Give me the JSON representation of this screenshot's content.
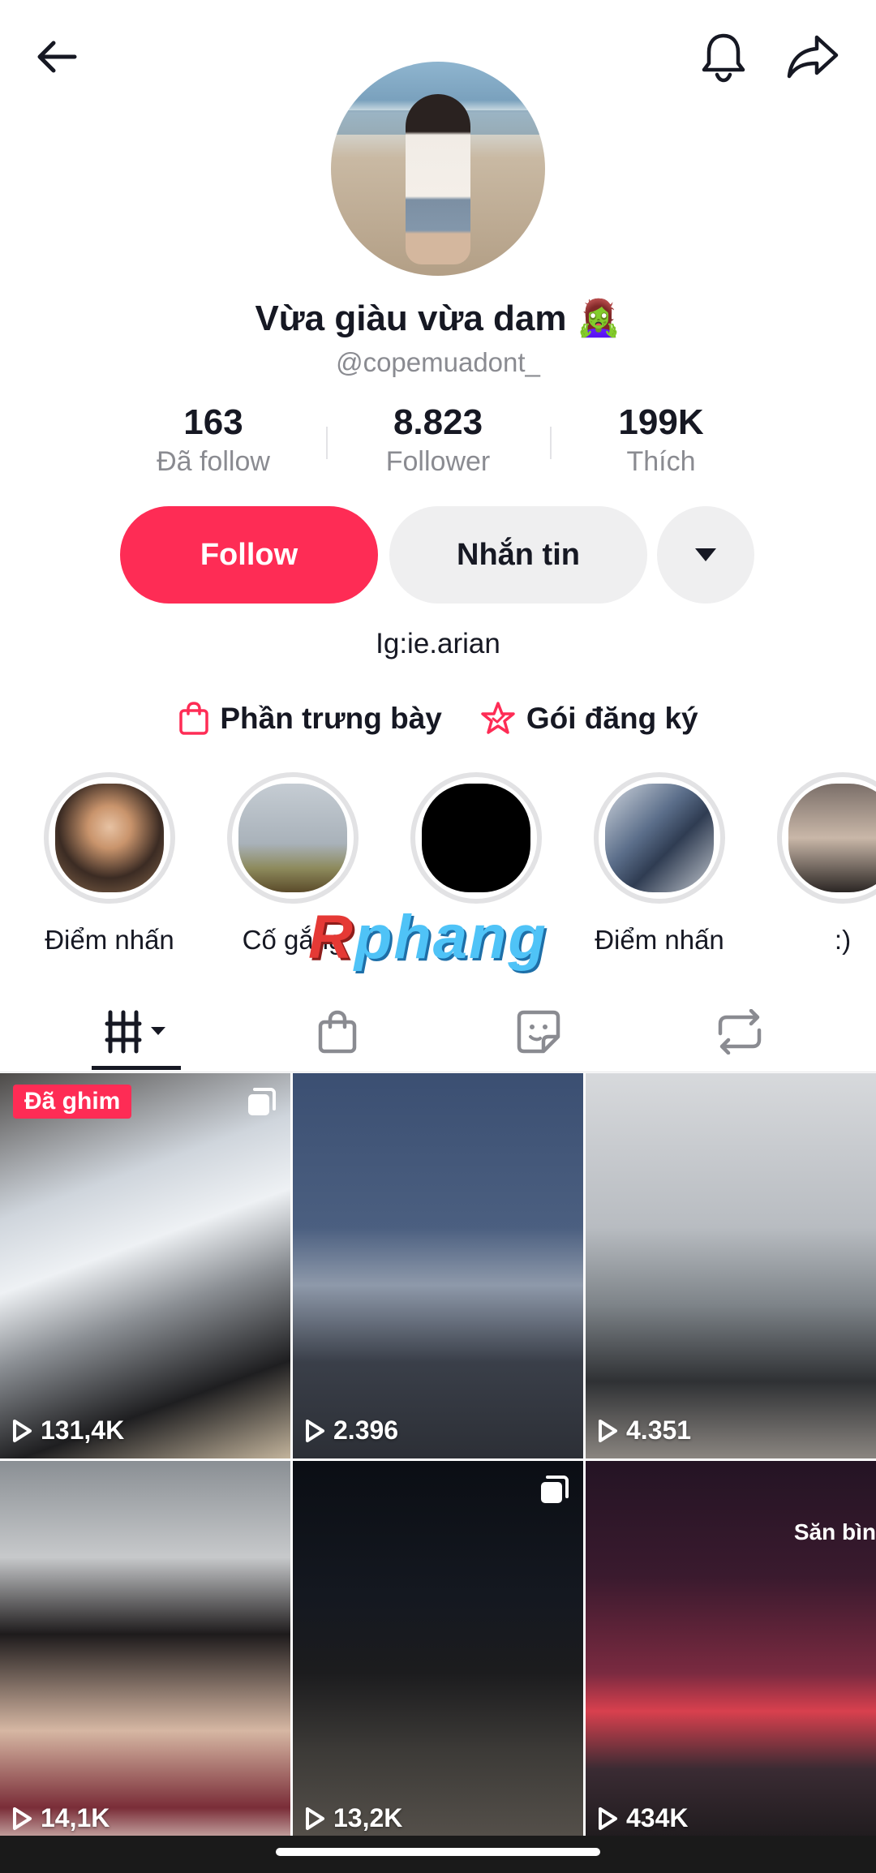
{
  "header": {
    "back_icon": "arrow-left-icon",
    "bell_icon": "bell-icon",
    "share_icon": "share-arrow-icon"
  },
  "profile": {
    "display_name": "Vừa giàu vừa dam 🧟‍♀️",
    "username": "@copemuadont_",
    "bio": "Ig:ie.arian"
  },
  "stats": [
    {
      "value": "163",
      "label": "Đã follow"
    },
    {
      "value": "8.823",
      "label": "Follower"
    },
    {
      "value": "199K",
      "label": "Thích"
    }
  ],
  "actions": {
    "follow_label": "Follow",
    "message_label": "Nhắn tin",
    "more_icon": "caret-down-icon"
  },
  "links": [
    {
      "label": "Phần trưng bày",
      "icon": "shopping-bag-icon"
    },
    {
      "label": "Gói đăng ký",
      "icon": "star-badge-icon"
    }
  ],
  "highlights": [
    {
      "caption": "Điểm nhấn"
    },
    {
      "caption": "Cố gắng"
    },
    {
      "caption": ""
    },
    {
      "caption": "Điểm nhấn"
    },
    {
      "caption": ":)"
    }
  ],
  "watermark": {
    "first": "R",
    "rest": "phang"
  },
  "tabs": [
    {
      "name": "videos",
      "icon": "grid-icon",
      "active": true
    },
    {
      "name": "shop",
      "icon": "shopping-bag-icon",
      "active": false
    },
    {
      "name": "favorites",
      "icon": "sticker-icon",
      "active": false
    },
    {
      "name": "reposts",
      "icon": "repost-icon",
      "active": false
    }
  ],
  "videos": [
    {
      "views": "131,4K",
      "pinned_label": "Đã ghim",
      "multi": true
    },
    {
      "views": "2.396"
    },
    {
      "views": "4.351"
    },
    {
      "views": "14,1K"
    },
    {
      "views": "13,2K",
      "multi": true
    },
    {
      "views": "434K",
      "overlay_text": "Săn bìn"
    }
  ],
  "colors": {
    "accent": "#fe2c55",
    "text": "#161823",
    "muted": "#8a8b91",
    "button_gray": "#efeff0"
  }
}
